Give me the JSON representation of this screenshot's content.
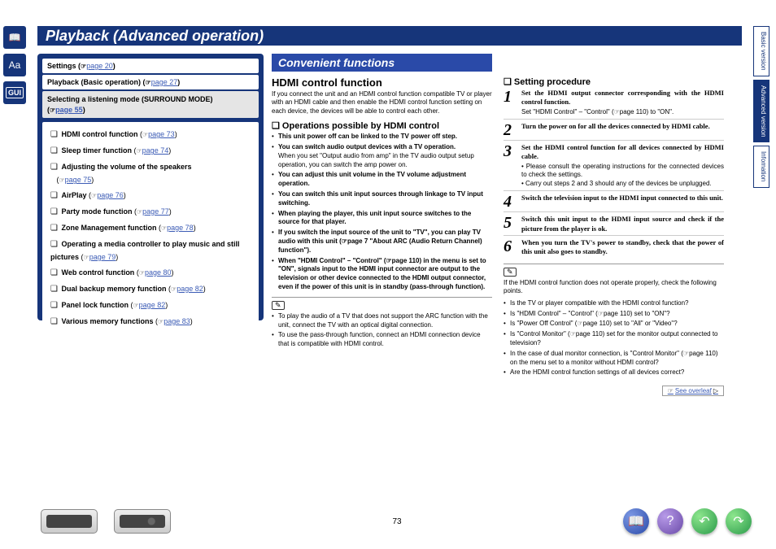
{
  "title": "Playback (Advanced operation)",
  "sideIcons": [
    "book-icon",
    "font-icon",
    "gui-icon"
  ],
  "rightTabs": [
    {
      "label": "Basic version",
      "active": false
    },
    {
      "label": "Advanced version",
      "active": true
    },
    {
      "label": "Infomation",
      "active": false
    }
  ],
  "nav": {
    "settings": {
      "label": "Settings",
      "ref": "page 20"
    },
    "playback": {
      "label": "Playback (Basic operation)",
      "ref": "page 27"
    },
    "surround": {
      "label": "Selecting a listening mode (SURROUND MODE)",
      "ref": "page 55"
    },
    "items": [
      {
        "title": "HDMI control function",
        "ref": "page 73"
      },
      {
        "title": "Sleep timer function",
        "ref": "page 74"
      },
      {
        "title": "Adjusting the volume of the speakers",
        "ref": "page 75",
        "refOnNewLine": true
      },
      {
        "title": "AirPlay",
        "ref": "page 76"
      },
      {
        "title": "Party mode function",
        "ref": "page 77"
      },
      {
        "title": "Zone Management function",
        "ref": "page 78"
      },
      {
        "title": "Operating a media controller to play music and still pictures",
        "ref": "page 79",
        "refOnNewLine": true
      },
      {
        "title": "Web control function",
        "ref": "page 80"
      },
      {
        "title": "Dual backup memory function",
        "ref": "page 82"
      },
      {
        "title": "Panel lock function",
        "ref": "page 82"
      },
      {
        "title": "Various memory functions",
        "ref": "page 83"
      }
    ]
  },
  "sectionBar": "Convenient functions",
  "hdmi": {
    "heading": "HDMI control function",
    "intro": "If you connect the unit and an HDMI control function compatible TV or player with an HDMI cable and then enable the HDMI control function setting on each device, the devices will be able to control each other.",
    "opsHeading": "Operations possible by HDMI control",
    "ops": [
      {
        "b": "This unit power off can be linked to the TV power off step.",
        "t": ""
      },
      {
        "b": "You can switch audio output devices with a TV operation.",
        "t": "When you set \"Output audio from amp\" in the TV audio output setup operation, you can switch the amp power on."
      },
      {
        "b": "You can adjust this unit volume in the TV volume adjustment operation.",
        "t": ""
      },
      {
        "b": "You can switch this unit input sources through linkage to TV input switching.",
        "t": ""
      },
      {
        "b": "When playing the player, this unit input source switches to the source for that player.",
        "t": ""
      },
      {
        "b": "If you switch the input source of the unit to \"TV\", you can play TV audio with this unit (☞page 7 \"About ARC (Audio Return Channel) function\").",
        "t": ""
      },
      {
        "b": "When \"HDMI Control\" – \"Control\" (☞page 110) in the menu is set to \"ON\", signals input to the HDMI input connector are output to the television or other device connected to the HDMI output connector, even if the power of this unit is in standby (pass-through function).",
        "t": ""
      }
    ],
    "notes": [
      "To play the audio of a TV that does not support the ARC function with the unit, connect the TV with an optical digital connection.",
      "To use the pass-through function, connect an HDMI connection device that is compatible with HDMI control."
    ]
  },
  "procedure": {
    "heading": "Setting procedure",
    "steps": [
      {
        "n": "1",
        "b": "Set the HDMI output connector corresponding with the HDMI control function.",
        "t": "Set \"HDMI Control\" – \"Control\" (☞page 110) to \"ON\"."
      },
      {
        "n": "2",
        "b": "Turn the power on for all the devices connected by HDMI cable.",
        "t": ""
      },
      {
        "n": "3",
        "b": "Set the HDMI control function for all devices connected by HDMI cable.",
        "t": "• Please consult the operating instructions for the connected devices to check the settings.\n• Carry out steps 2 and 3 should any of the devices be unplugged."
      },
      {
        "n": "4",
        "b": "Switch the television input to the HDMI input connected to this unit.",
        "t": ""
      },
      {
        "n": "5",
        "b": "Switch this unit input to the HDMI input source and check if the picture from the player is ok.",
        "t": ""
      },
      {
        "n": "6",
        "b": "When you turn the TV's power to standby, check that the power of this unit also goes to standby.",
        "t": ""
      }
    ],
    "troubleIntro": "If the HDMI control function does not operate properly, check the following points.",
    "trouble": [
      "Is the TV or player compatible with the HDMI control function?",
      "Is \"HDMI Control\" – \"Control\" (☞page 110) set to \"ON\"?",
      "Is \"Power Off Control\" (☞page 110) set to \"All\" or \"Video\"?",
      "Is \"Control Monitor\" (☞page 110) set for the monitor output connected to television?",
      "In the case of dual monitor connection, is \"Control Monitor\" (☞page 110) on the menu set to a monitor without HDMI control?",
      "Are the HDMI control function settings of all devices correct?"
    ],
    "seeOverleaf": "See overleaf"
  },
  "pageNumber": "73"
}
